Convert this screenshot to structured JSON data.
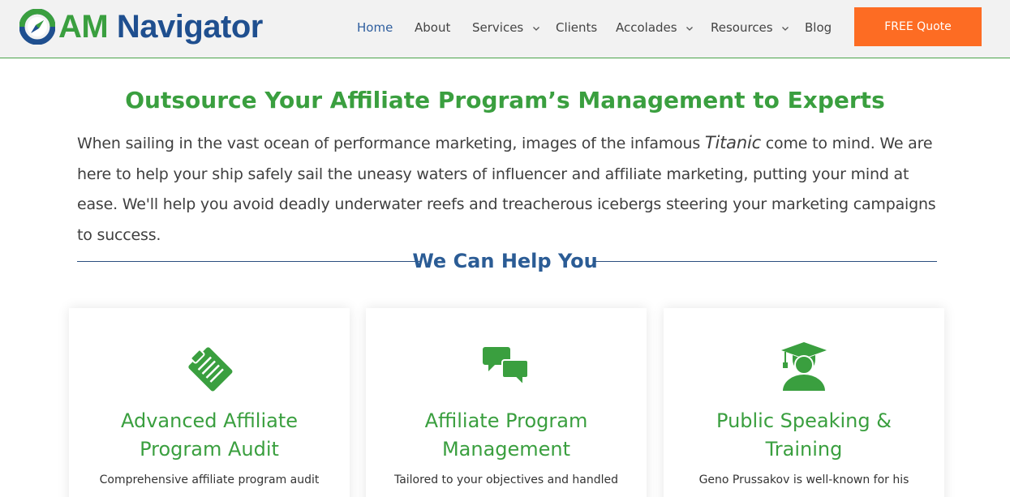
{
  "brand": {
    "name_part1": "AM",
    "name_part2": "Navigator",
    "logo_icon": "compass-logo-icon",
    "green": "#3a9f3f",
    "blue": "#1f4f8f",
    "accent": "#fd6c23"
  },
  "nav": {
    "items": [
      {
        "label": "Home",
        "active": true,
        "dropdown": false
      },
      {
        "label": "About",
        "active": false,
        "dropdown": false
      },
      {
        "label": "Services",
        "active": false,
        "dropdown": true
      },
      {
        "label": "Clients",
        "active": false,
        "dropdown": false
      },
      {
        "label": "Accolades",
        "active": false,
        "dropdown": true
      },
      {
        "label": "Resources",
        "active": false,
        "dropdown": true
      },
      {
        "label": "Blog",
        "active": false,
        "dropdown": false
      }
    ],
    "cta_label": "FREE Quote"
  },
  "main": {
    "title": "Outsource Your Affiliate Program’s Management to Experts",
    "intro_before": "When sailing in the vast ocean of performance marketing, images of the infamous ",
    "intro_em": "Titanic",
    "intro_after": " come to mind. We are here to help your ship safely sail the uneasy waters of influencer and affiliate marketing, putting your mind at ease. We'll help you avoid deadly underwater reefs and treacherous icebergs steering your marketing campaigns to success.",
    "section_title": "We Can Help You"
  },
  "cards": [
    {
      "icon": "clipboard-checklist-icon",
      "title": "Advanced Affiliate Program Audit",
      "text": "Comprehensive affiliate program audit"
    },
    {
      "icon": "chat-bubbles-icon",
      "title": "Affiliate Program Management",
      "text": "Tailored to your objectives and handled"
    },
    {
      "icon": "graduate-icon",
      "title": "Public Speaking & Training",
      "text": "Geno Prussakov is well-known for his"
    }
  ]
}
